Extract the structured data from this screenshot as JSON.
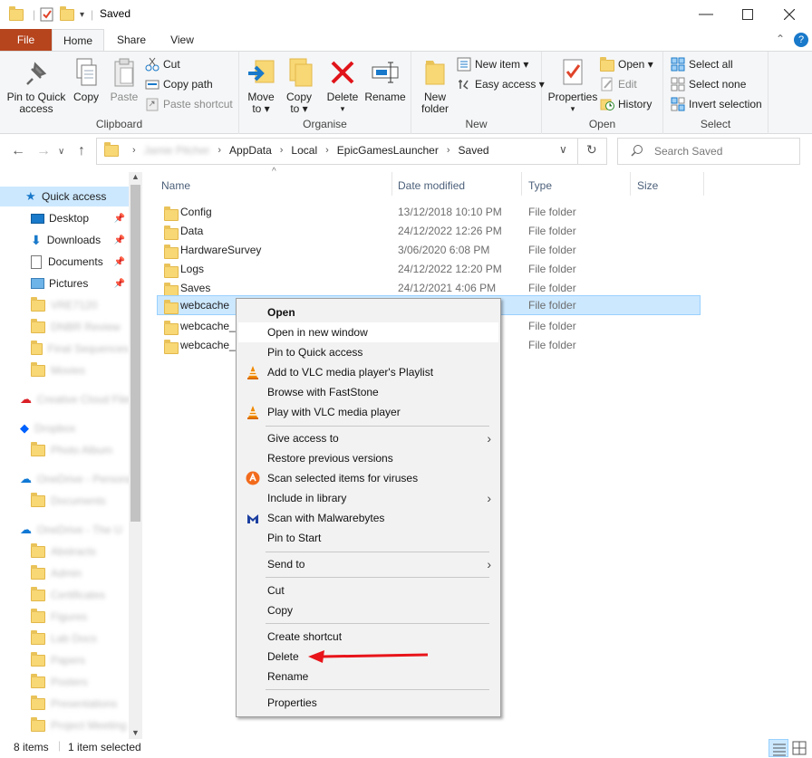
{
  "window": {
    "title": "Saved"
  },
  "ribbon_tabs": {
    "file": "File",
    "home": "Home",
    "share": "Share",
    "view": "View"
  },
  "clipboard": {
    "pin": "Pin to Quick access",
    "copy": "Copy",
    "paste": "Paste",
    "cut": "Cut",
    "copy_path": "Copy path",
    "paste_shortcut": "Paste shortcut",
    "label": "Clipboard"
  },
  "organise": {
    "move_to": "Move to",
    "copy_to": "Copy to",
    "delete": "Delete",
    "rename": "Rename",
    "label": "Organise"
  },
  "new_group": {
    "new_folder": "New folder",
    "new_item": "New item",
    "easy_access": "Easy access",
    "label": "New"
  },
  "open_group": {
    "properties": "Properties",
    "open": "Open",
    "edit": "Edit",
    "history": "History",
    "label": "Open"
  },
  "select_group": {
    "select_all": "Select all",
    "select_none": "Select none",
    "invert": "Invert selection",
    "label": "Select"
  },
  "address": {
    "user": "Jamie Pitcher",
    "crumbs": [
      "AppData",
      "Local",
      "EpicGamesLauncher",
      "Saved"
    ]
  },
  "search": {
    "placeholder": "Search Saved"
  },
  "nav": {
    "quick_access": "Quick access",
    "desktop": "Desktop",
    "downloads": "Downloads",
    "documents": "Documents",
    "pictures": "Pictures",
    "blurred": [
      "VRE7120",
      "DNBR Review",
      "Final Sequences",
      "Movies",
      "Creative Cloud Files",
      "Dropbox",
      "Photo Album",
      "OneDrive - Personal",
      "Documents",
      "OneDrive - The U",
      "Abstracts",
      "Admin",
      "Certificates",
      "Figures",
      "Lab Docs",
      "Papers",
      "Posters",
      "Presentations",
      "Project Meeting"
    ]
  },
  "columns": {
    "name": "Name",
    "date": "Date modified",
    "type": "Type",
    "size": "Size"
  },
  "files": [
    {
      "name": "Config",
      "date": "13/12/2018 10:10 PM",
      "type": "File folder"
    },
    {
      "name": "Data",
      "date": "24/12/2022 12:26 PM",
      "type": "File folder"
    },
    {
      "name": "HardwareSurvey",
      "date": "3/06/2020 6:08 PM",
      "type": "File folder"
    },
    {
      "name": "Logs",
      "date": "24/12/2022 12:20 PM",
      "type": "File folder"
    },
    {
      "name": "Saves",
      "date": "24/12/2021 4:06 PM",
      "type": "File folder"
    },
    {
      "name": "webcache",
      "date": "",
      "type": "File folder"
    },
    {
      "name": "webcache_4",
      "date": "",
      "type": "File folder"
    },
    {
      "name": "webcache_4",
      "date": "",
      "type": "File folder"
    }
  ],
  "context_menu": {
    "open": "Open",
    "open_new_window": "Open in new window",
    "pin_quick": "Pin to Quick access",
    "vlc_playlist": "Add to VLC media player's Playlist",
    "faststone": "Browse with FastStone",
    "vlc_play": "Play with VLC media player",
    "give_access": "Give access to",
    "restore": "Restore previous versions",
    "scan_virus": "Scan selected items for viruses",
    "include_library": "Include in library",
    "malwarebytes": "Scan with Malwarebytes",
    "pin_start": "Pin to Start",
    "send_to": "Send to",
    "cut": "Cut",
    "copy": "Copy",
    "create_shortcut": "Create shortcut",
    "delete": "Delete",
    "rename": "Rename",
    "properties": "Properties"
  },
  "status": {
    "items": "8 items",
    "selected": "1 item selected"
  },
  "colors": {
    "accent": "#1979ca",
    "file_tab": "#b6441d",
    "selection": "#cce8ff",
    "arrow": "#e8141a"
  }
}
